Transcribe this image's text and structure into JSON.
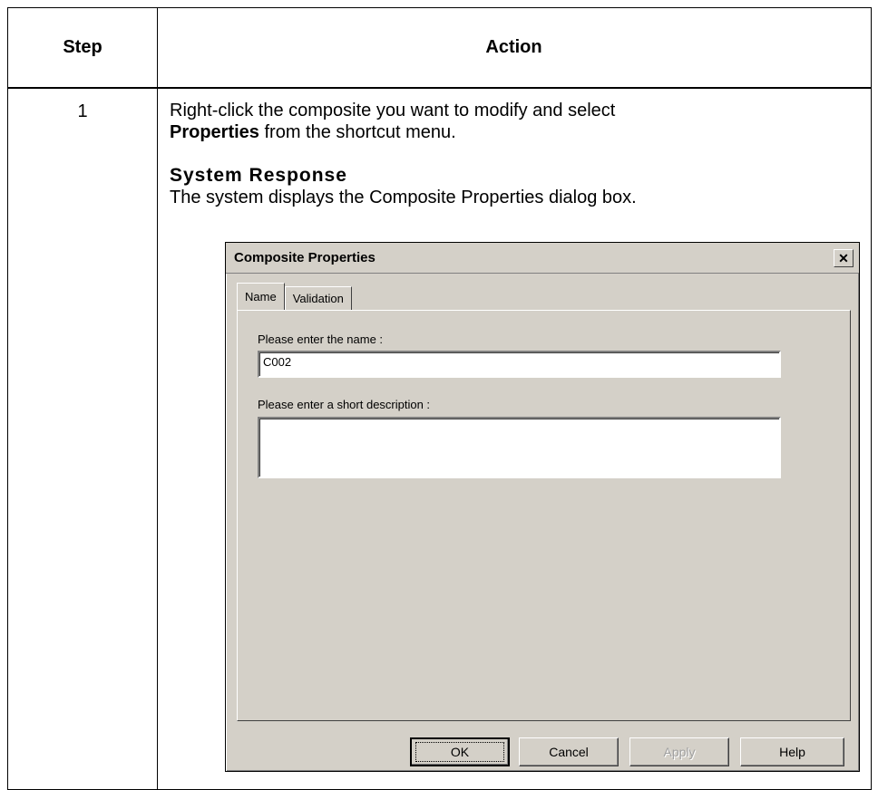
{
  "table": {
    "header_step": "Step",
    "header_action": "Action",
    "step_number": "1",
    "instruction_part1": "Right-click the composite you want to modify and select",
    "instruction_bold": "Properties",
    "instruction_part2": " from the shortcut menu.",
    "system_response_title": "System Response",
    "system_response_text": "The system displays the Composite Properties dialog box."
  },
  "dialog": {
    "title": "Composite Properties",
    "close_glyph": "✕",
    "tabs": [
      {
        "label": "Name",
        "active": true
      },
      {
        "label": "Validation",
        "active": false
      }
    ],
    "name_label": "Please enter the name :",
    "name_value": "C002",
    "description_label": "Please enter a short description :",
    "description_value": "",
    "buttons": {
      "ok": "OK",
      "cancel": "Cancel",
      "apply": "Apply",
      "help": "Help"
    }
  }
}
